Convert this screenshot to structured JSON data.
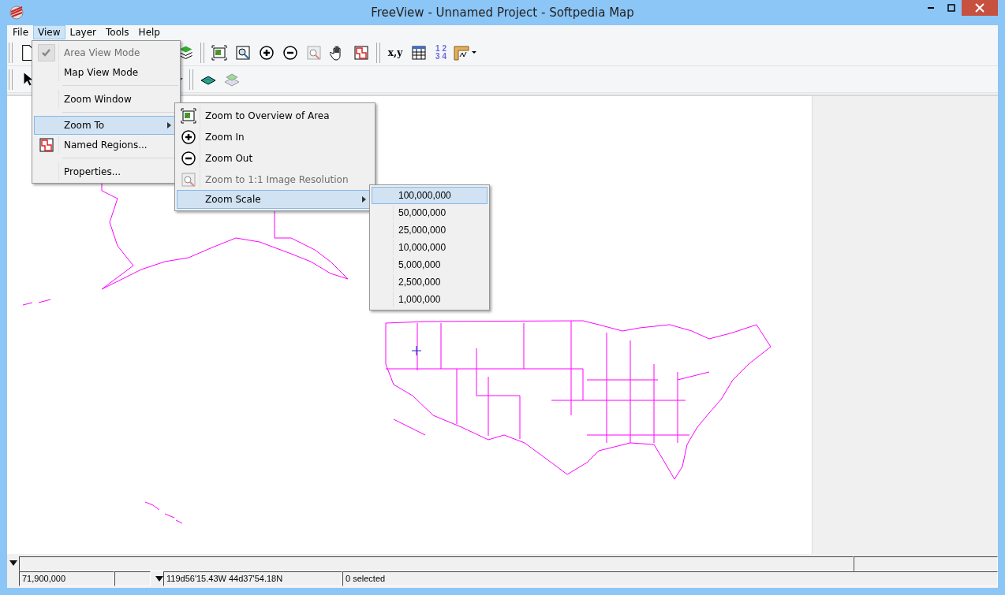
{
  "window": {
    "title": "FreeView - Unnamed Project - Softpedia Map"
  },
  "menu_bar": [
    {
      "label": "File",
      "selected": false
    },
    {
      "label": "View",
      "selected": true
    },
    {
      "label": "Layer",
      "selected": false
    },
    {
      "label": "Tools",
      "selected": false
    },
    {
      "label": "Help",
      "selected": false
    }
  ],
  "toolbar_1": [
    {
      "kind": "new-file"
    },
    {
      "kind": "gap"
    },
    {
      "kind": "layers"
    },
    {
      "kind": "sep"
    },
    {
      "kind": "overview"
    },
    {
      "kind": "zoom-window"
    },
    {
      "kind": "zoom-in"
    },
    {
      "kind": "zoom-out"
    },
    {
      "kind": "zoom-1to1"
    },
    {
      "kind": "pan"
    },
    {
      "kind": "regions"
    },
    {
      "kind": "sep"
    },
    {
      "kind": "xy",
      "label": "x,y"
    },
    {
      "kind": "table"
    },
    {
      "kind": "digits",
      "label": "1 2 3 4"
    },
    {
      "kind": "ruler"
    }
  ],
  "toolbar_2": [
    {
      "kind": "pointer"
    },
    {
      "kind": "gap"
    },
    {
      "kind": "caret"
    },
    {
      "kind": "sep"
    },
    {
      "kind": "layer-color"
    },
    {
      "kind": "layer-outline"
    }
  ],
  "view_menu": [
    {
      "kind": "item",
      "label": "Area View Mode",
      "checked": true,
      "disabled": true,
      "selected": false
    },
    {
      "kind": "item",
      "label": "Map View Mode",
      "checked": false,
      "disabled": false,
      "selected": false
    },
    {
      "kind": "separator"
    },
    {
      "kind": "item",
      "label": "Zoom Window",
      "checked": false,
      "disabled": false,
      "selected": false
    },
    {
      "kind": "separator"
    },
    {
      "kind": "submenu",
      "label": "Zoom To",
      "checked": false,
      "disabled": false,
      "selected": true
    },
    {
      "kind": "regions",
      "label": "Named Regions...",
      "checked": false,
      "disabled": false,
      "selected": false
    },
    {
      "kind": "separator"
    },
    {
      "kind": "item",
      "label": "Properties...",
      "checked": false,
      "disabled": false,
      "selected": false
    }
  ],
  "zoom_to_menu": [
    {
      "kind": "overview",
      "label": "Zoom to Overview of Area",
      "disabled": false,
      "selected": false
    },
    {
      "kind": "zoom-in",
      "label": "Zoom In",
      "disabled": false,
      "selected": false
    },
    {
      "kind": "zoom-out",
      "label": "Zoom Out",
      "disabled": false,
      "selected": false
    },
    {
      "kind": "zoom-1to1",
      "label": "Zoom to 1:1 Image Resolution",
      "disabled": true,
      "selected": false
    },
    {
      "kind": "submenu",
      "label": "Zoom Scale",
      "disabled": false,
      "selected": true
    }
  ],
  "zoom_scale_menu": [
    {
      "label": "100,000,000",
      "selected": true
    },
    {
      "label": "50,000,000",
      "selected": false
    },
    {
      "label": "25,000,000",
      "selected": false
    },
    {
      "label": "10,000,000",
      "selected": false
    },
    {
      "label": "5,000,000",
      "selected": false
    },
    {
      "label": "2,500,000",
      "selected": false
    },
    {
      "label": "1,000,000",
      "selected": false
    }
  ],
  "status_bar": {
    "scale": "71,900,000",
    "coordinates": "119d56'15.43W  44d37'54.18N",
    "selection": "0 selected"
  }
}
